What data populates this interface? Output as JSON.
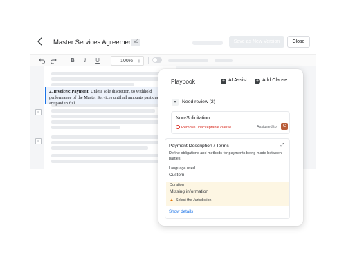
{
  "header": {
    "title": "Master Services Agreement",
    "version_badge": "V3",
    "save_label": "Save as New Version",
    "close_label": "Close"
  },
  "toolbar": {
    "undo_icon": "undo-icon",
    "redo_icon": "redo-icon",
    "bold": "B",
    "italic": "I",
    "underline": "U",
    "zoom_minus": "−",
    "zoom": "100%",
    "zoom_plus": "+"
  },
  "document": {
    "clause_heading": "2. Invoices; Payment.",
    "clause_text": "Unless sole discretion, to withhold performance of the Master Services until all amounts past due are paid in full."
  },
  "playbook": {
    "title": "Playbook",
    "ai_assist": "AI Assist",
    "add_clause": "Add Clause",
    "need_review": "Need review (2)",
    "items": [
      {
        "title": "Non-Solicitation",
        "warning": "Remove unacceptable clause",
        "assigned_label": "Assigned to",
        "assignee_initial": "C"
      }
    ],
    "payment": {
      "title": "Payment Description / Terms",
      "description": "Define obligations and methods for payments being made between parties.",
      "language_label": "Language used",
      "language_value": "Custom",
      "duration_label": "Duration",
      "duration_value": "Missing information",
      "jurisdiction_warning": "Select the Jurisdiction",
      "show_details": "Show details"
    }
  },
  "colors": {
    "accent": "#1a73e8",
    "warning_red": "#d93025",
    "highlight_bg": "#fdf6e3",
    "avatar_bg": "#b85c38"
  }
}
